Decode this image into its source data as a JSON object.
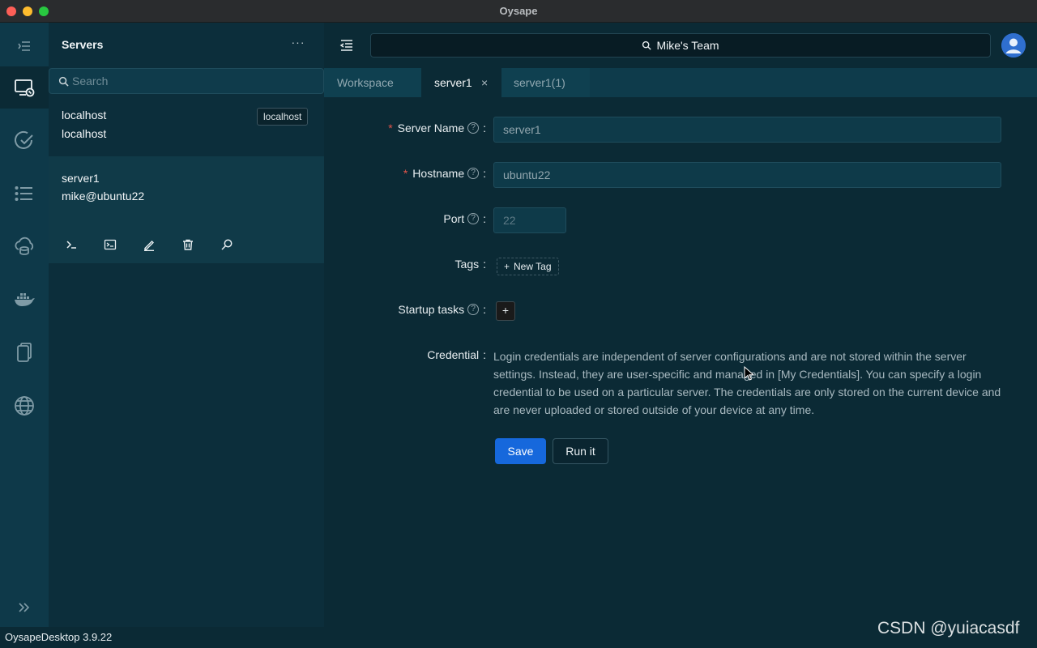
{
  "window": {
    "title": "Oysape"
  },
  "rail": {
    "icons": [
      "list-indent-icon",
      "server-monitor-icon",
      "check-circle-icon",
      "list-icon",
      "cloud-database-icon",
      "docker-icon",
      "files-icon",
      "globe-icon",
      "expand-icon"
    ]
  },
  "servers_panel": {
    "title": "Servers",
    "more_label": "···",
    "search": {
      "placeholder": "Search",
      "value": ""
    },
    "servers": [
      {
        "name": "localhost",
        "subtitle": "localhost",
        "tag": "localhost"
      },
      {
        "name": "server1",
        "subtitle": "mike@ubuntu22"
      }
    ]
  },
  "footer": {
    "version": "OysapeDesktop 3.9.22"
  },
  "topbar": {
    "team": "Mike's Team"
  },
  "tabs": [
    {
      "label": "Workspace"
    },
    {
      "label": "server1",
      "active": true,
      "closable": true
    },
    {
      "label": "server1(1)"
    }
  ],
  "tab_close": "×",
  "form": {
    "server_name": {
      "label": "Server Name",
      "value": "server1",
      "required": true
    },
    "hostname": {
      "label": "Hostname",
      "value": "ubuntu22",
      "required": true
    },
    "port": {
      "label": "Port",
      "placeholder": "22"
    },
    "tags": {
      "label": "Tags",
      "new_tag": "New Tag"
    },
    "startup_tasks": {
      "label": "Startup tasks",
      "add": "+"
    },
    "credential": {
      "label": "Credential",
      "text": "Login credentials are independent of server configurations and are not stored within the server settings. Instead, they are user-specific and managed in [My Credentials]. You can specify a login credential to be used on a particular server. The credentials are only stored on the current device and are never uploaded or stored outside of your device at any time."
    },
    "required_mark": "*",
    "help_mark": "?",
    "colon": ":",
    "save_label": "Save",
    "run_label": "Run it"
  },
  "watermark": "CSDN @yuiacasdf",
  "colors": {
    "accent": "#1668dc",
    "required": "#e2544a",
    "background": "#0b2a35",
    "panel": "#0c2e3b",
    "rail": "#0e3949"
  }
}
